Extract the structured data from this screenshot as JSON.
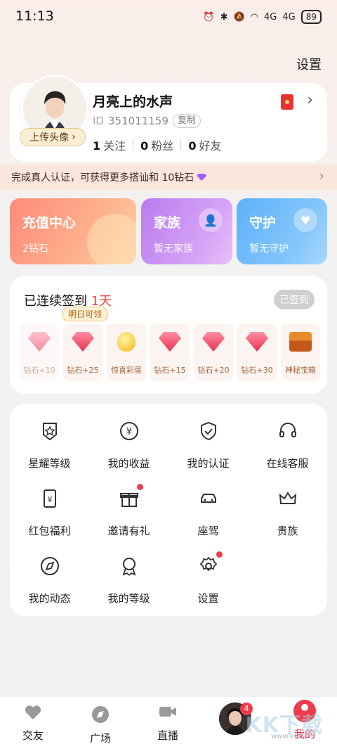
{
  "status_bar": {
    "time": "11:13",
    "signal": "4G",
    "signal2": "4G",
    "battery": "89"
  },
  "header": {
    "settings_label": "设置"
  },
  "profile": {
    "nickname": "月亮上的水声",
    "id_tag": "ID",
    "id_value": "351011159",
    "copy_label": "复制",
    "upload_label": "上传头像",
    "stats": [
      {
        "num": "1",
        "label": "关注"
      },
      {
        "num": "0",
        "label": "粉丝"
      },
      {
        "num": "0",
        "label": "好友"
      }
    ]
  },
  "verify_banner": {
    "text": "完成真人认证，可获得更多搭讪和 10钻石"
  },
  "features": [
    {
      "title": "充值中心",
      "subtitle": "2钻石",
      "color": "#ff9a84"
    },
    {
      "title": "家族",
      "subtitle": "暂无家族",
      "color": "#c58af2"
    },
    {
      "title": "守护",
      "subtitle": "暂无守护",
      "color": "#6bb8fb"
    }
  ],
  "signin": {
    "title_prefix": "已连续签到 ",
    "days": "1天",
    "signed_label": "已签到",
    "tomorrow_badge": "明日可领",
    "rewards": [
      {
        "label": "钻石+10",
        "icon": "gem-icon",
        "done": true
      },
      {
        "label": "钻石+25",
        "icon": "gem-icon",
        "done": false
      },
      {
        "label": "惊喜彩蛋",
        "icon": "egg-icon",
        "done": false
      },
      {
        "label": "钻石+15",
        "icon": "gem-icon",
        "done": false
      },
      {
        "label": "钻石+20",
        "icon": "gem-icon",
        "done": false
      },
      {
        "label": "钻石+30",
        "icon": "gem-icon",
        "done": false
      },
      {
        "label": "神秘宝箱",
        "icon": "chest-icon",
        "done": false
      }
    ]
  },
  "menu": [
    {
      "label": "星耀等级",
      "icon": "star-badge-icon",
      "dot": false
    },
    {
      "label": "我的收益",
      "icon": "yuan-coin-icon",
      "dot": false
    },
    {
      "label": "我的认证",
      "icon": "shield-check-icon",
      "dot": false
    },
    {
      "label": "在线客服",
      "icon": "headset-icon",
      "dot": false
    },
    {
      "label": "红包福利",
      "icon": "red-packet-icon",
      "dot": false
    },
    {
      "label": "邀请有礼",
      "icon": "gift-icon",
      "dot": true
    },
    {
      "label": "座驾",
      "icon": "car-icon",
      "dot": false
    },
    {
      "label": "贵族",
      "icon": "crown-icon",
      "dot": false
    },
    {
      "label": "我的动态",
      "icon": "compass-icon",
      "dot": false
    },
    {
      "label": "我的等级",
      "icon": "medal-icon",
      "dot": false
    },
    {
      "label": "设置",
      "icon": "gear-icon",
      "dot": true
    }
  ],
  "tabs": {
    "friends": "交友",
    "square": "广场",
    "live": "直播",
    "avatar_badge": "4",
    "mine": "我的"
  },
  "watermark": {
    "text": "KK下载",
    "url": "www.kkx.net"
  }
}
